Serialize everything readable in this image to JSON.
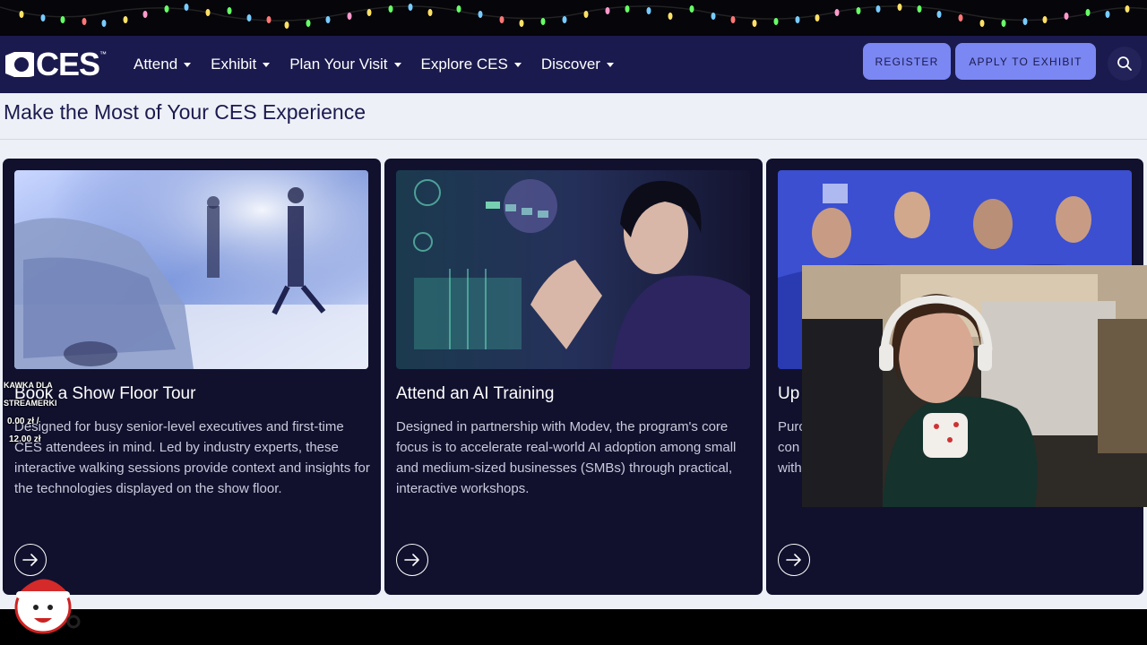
{
  "nav": {
    "logo_text": "CES",
    "menu": [
      {
        "label": "Attend"
      },
      {
        "label": "Exhibit"
      },
      {
        "label": "Plan Your Visit"
      },
      {
        "label": "Explore CES"
      },
      {
        "label": "Discover"
      }
    ],
    "register_label": "REGISTER",
    "apply_label": "APPLY TO EXHIBIT"
  },
  "section": {
    "title": "Make the Most of Your CES Experience"
  },
  "cards": [
    {
      "title": "Book a Show Floor Tour",
      "description": "Designed for busy senior-level executives and first-time CES attendees in mind. Led by industry experts, these interactive walking sessions provide context and insights for the technologies displayed on the show floor."
    },
    {
      "title": "Attend an AI Training",
      "description": "Designed in partnership with Modev, the program's core focus is to accelerate real-world AI adoption among small and medium-sized businesses (SMBs) through practical, interactive workshops."
    },
    {
      "title": "Up",
      "description_lines": [
        "Purc",
        "con",
        "with"
      ]
    }
  ],
  "stream_overlay": {
    "label_1": "KAWKA DLA",
    "label_2": "STREAMERKI",
    "amount": "0.00 zł /",
    "goal": "12.00 zł"
  },
  "colors": {
    "nav_bg": "#1a1a4e",
    "button_bg": "#7b87f2",
    "card_bg": "#11112e",
    "page_bg": "#eef0f7"
  }
}
